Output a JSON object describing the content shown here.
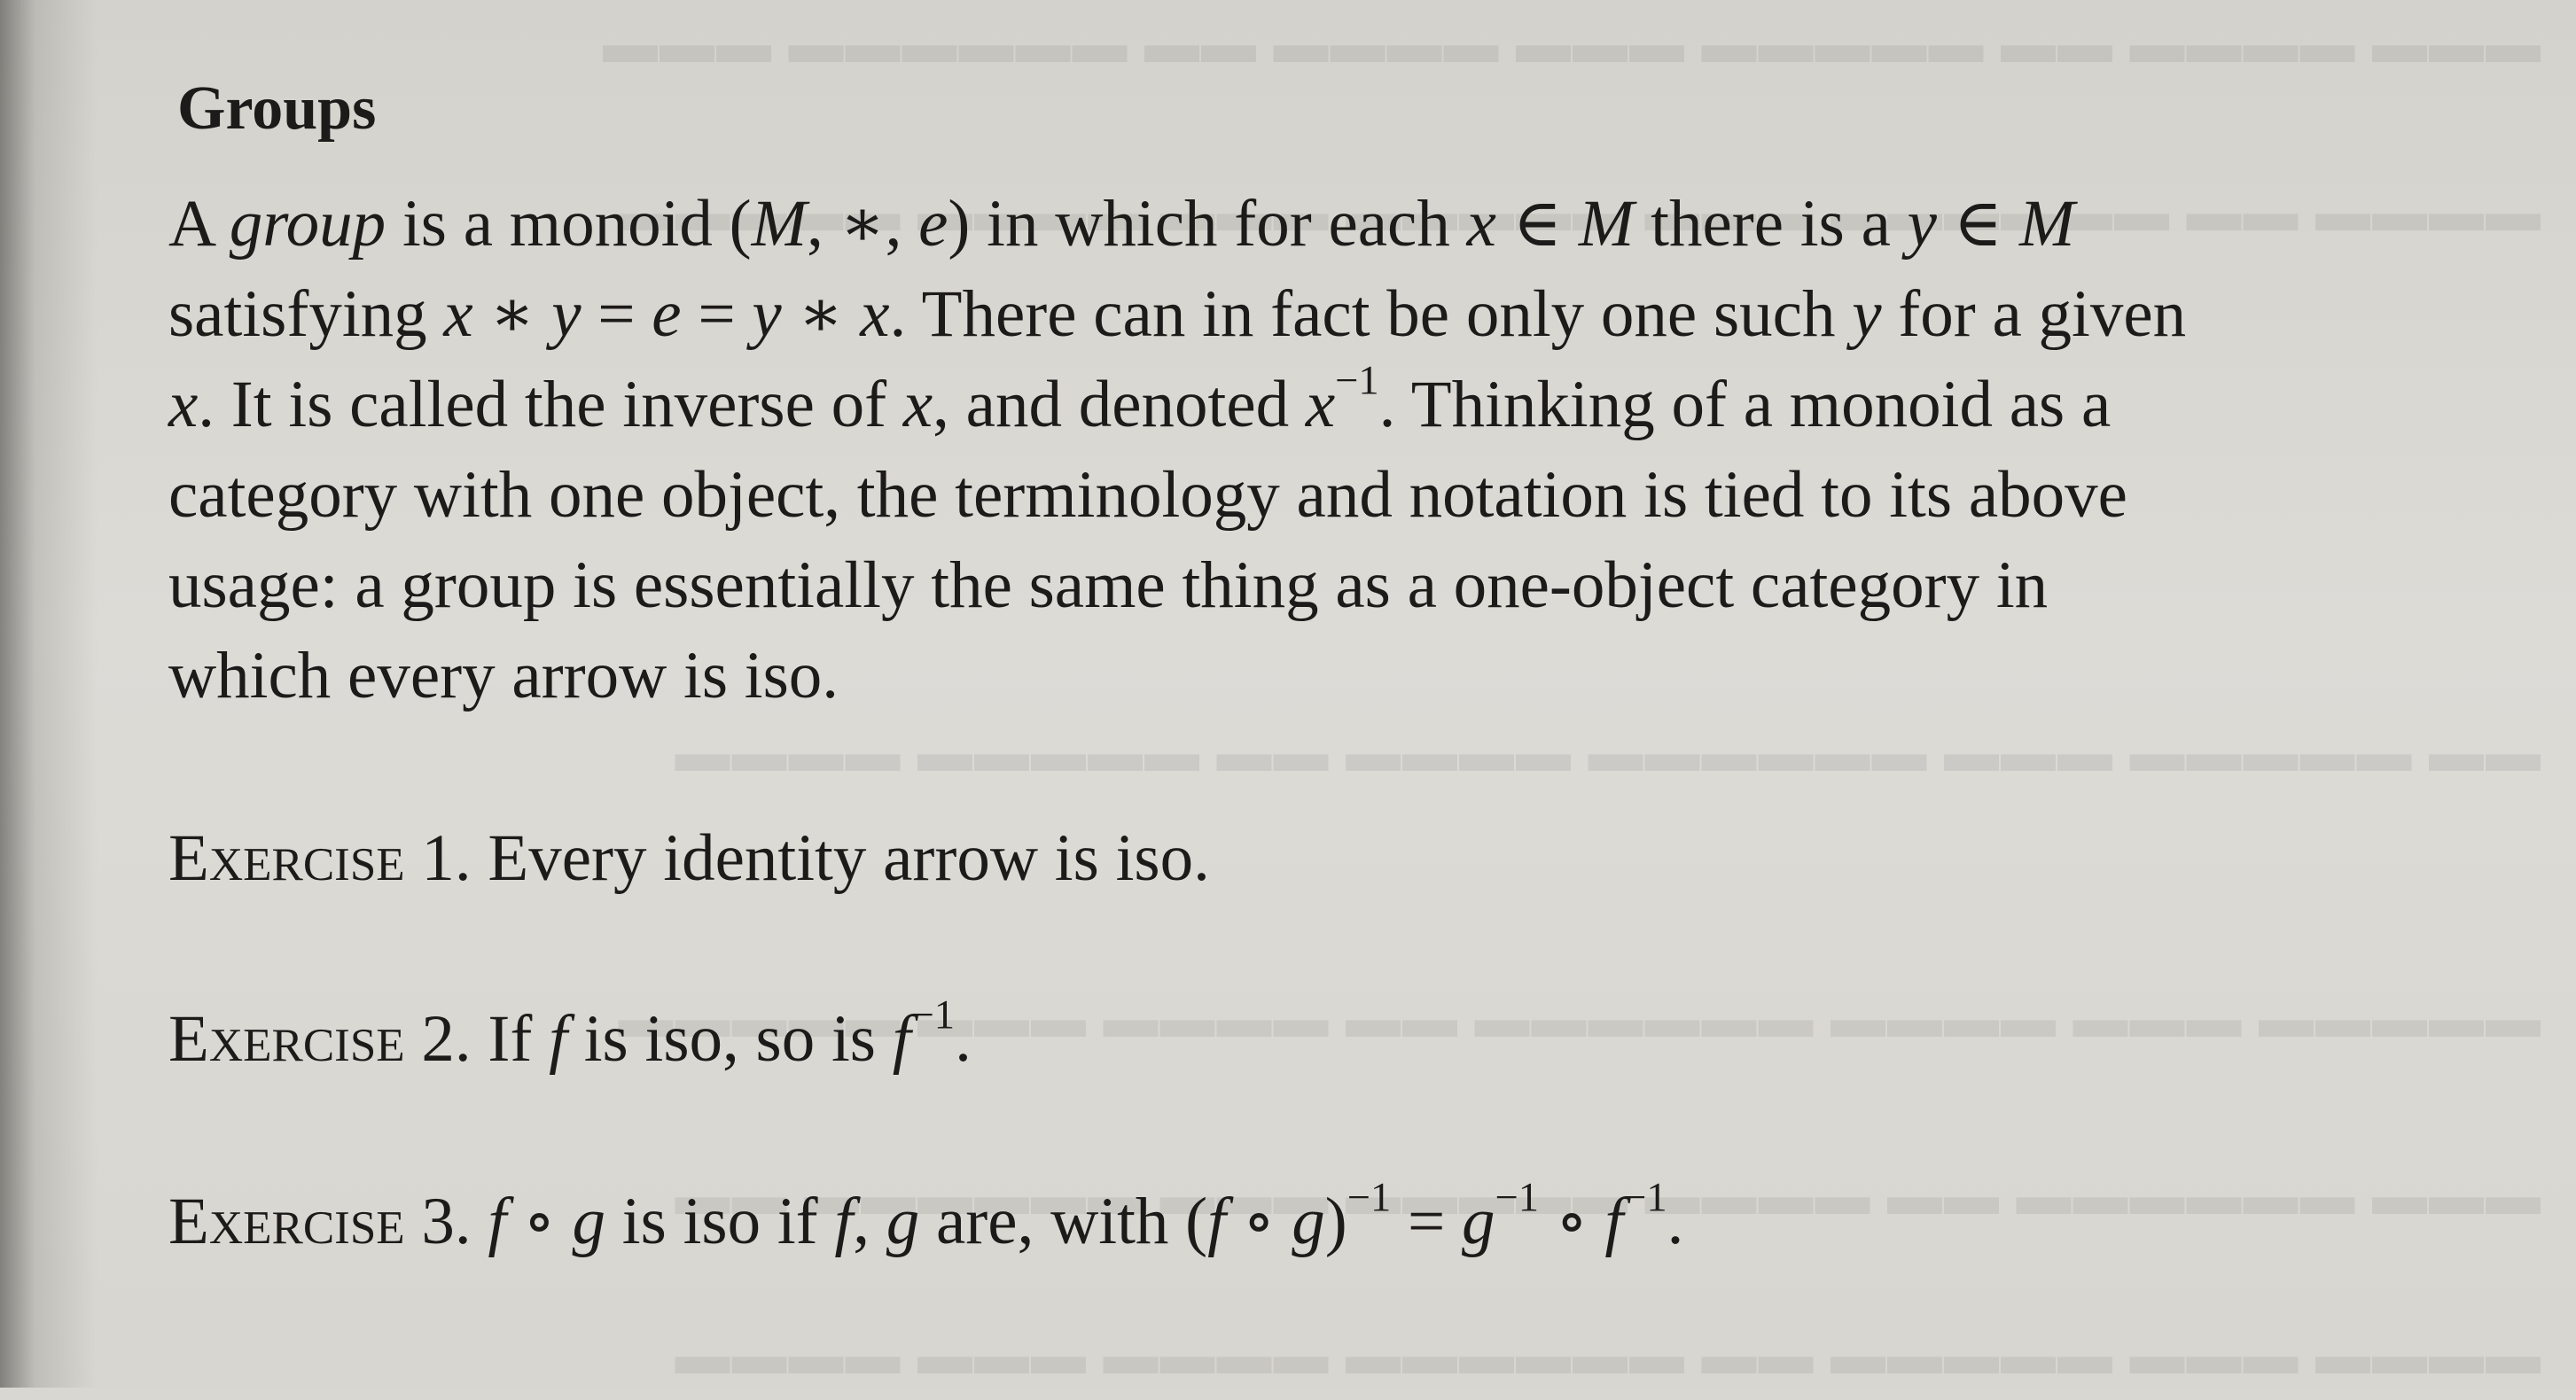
{
  "heading": "Groups",
  "paragraph": {
    "l1": {
      "a": "A ",
      "b": "group",
      "c": " is a monoid (",
      "d": "M",
      "e": ", ∗, ",
      "f": "e",
      "g": ") in which for each ",
      "h": "x",
      "i": " ∈ ",
      "j": "M",
      "k": " there is a ",
      "l": "y",
      "m": " ∈ ",
      "n": "M"
    },
    "l2": {
      "a": "satisfying ",
      "b": "x",
      "c": " ∗ ",
      "d": "y",
      "e": " = ",
      "f": "e",
      "g": " = ",
      "h": "y",
      "i": " ∗ ",
      "j": "x",
      "k": ". There can in fact be only one such ",
      "l": "y",
      "m": " for a given"
    },
    "l3": {
      "a": "x",
      "b": ". It is called the inverse of ",
      "c": "x",
      "d": ", and denoted ",
      "e": "x",
      "f": "−1",
      "g": ". Thinking of a monoid as a"
    },
    "l4": "category with one object, the terminology and notation is tied to its above",
    "l5": "usage: a group is essentially the same thing as a one-object category in",
    "l6": "which every arrow is iso."
  },
  "exercise1": {
    "label": "Exercise",
    "number": " 1. ",
    "text": "Every identity arrow is iso."
  },
  "exercise2": {
    "label": "Exercise",
    "number": " 2. ",
    "a": "If ",
    "b": "f",
    "c": " is iso, so is ",
    "d": "f",
    "e": "−1",
    "f": "."
  },
  "exercise3": {
    "label": "Exercise",
    "number": " 3. ",
    "a": "f",
    "b": " ∘ ",
    "c": "g",
    "d": " is iso if ",
    "e": "f",
    "f": ", ",
    "g": "g",
    "h": " are, with (",
    "i": "f",
    "j": " ∘ ",
    "k": "g",
    "l": ")",
    "m": "−1",
    "n": " = ",
    "o": "g",
    "p": "−1",
    "q": " ∘ ",
    "r": "f",
    "s": "−1",
    "t": "."
  }
}
